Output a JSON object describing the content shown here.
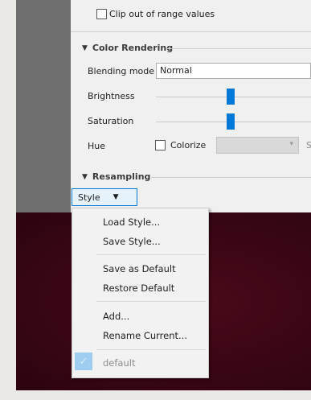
{
  "clip_checkbox": {
    "label": "Clip out of range values",
    "checked": false
  },
  "color_rendering": {
    "title": "Color Rendering",
    "blending_label": "Blending mode",
    "blending_value": "Normal",
    "brightness_label": "Brightness",
    "brightness_level": 0.5,
    "saturation_label": "Saturation",
    "saturation_level": 0.5,
    "hue_label": "Hue",
    "colorize_label": "Colorize",
    "colorize_checked": false
  },
  "resampling": {
    "title": "Resampling"
  },
  "style_button": {
    "label": "Style"
  },
  "style_menu": {
    "items": [
      {
        "label": "Load Style..."
      },
      {
        "label": "Save Style..."
      },
      {
        "label": "Save as Default"
      },
      {
        "label": "Restore Default"
      },
      {
        "label": "Add..."
      },
      {
        "label": "Rename Current..."
      },
      {
        "label": "default",
        "checked": true,
        "disabled": true
      }
    ]
  },
  "colors": {
    "accent": "#0078d7",
    "canvas": "#3a0614",
    "menu_bg": "#f2f2f2",
    "gray_panel": "#6e6e6e"
  },
  "icons": {
    "collapse": "triangle-down-icon",
    "dropdown": "chevron-down-icon",
    "check": "check-icon"
  }
}
